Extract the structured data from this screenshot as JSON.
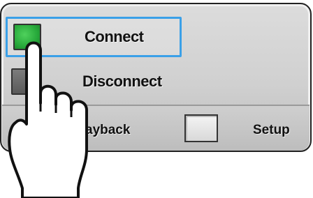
{
  "menu": {
    "connect": {
      "label": "Connect",
      "checked": true,
      "highlight_color": "#3aa0e8",
      "checkbox_color": "#2cb840"
    },
    "disconnect": {
      "label": "Disconnect",
      "checked": false
    }
  },
  "bottom_bar": {
    "playback_label": "ayback",
    "setup_label": "Setup"
  },
  "icons": {
    "pointer": "pointing-hand-icon"
  }
}
